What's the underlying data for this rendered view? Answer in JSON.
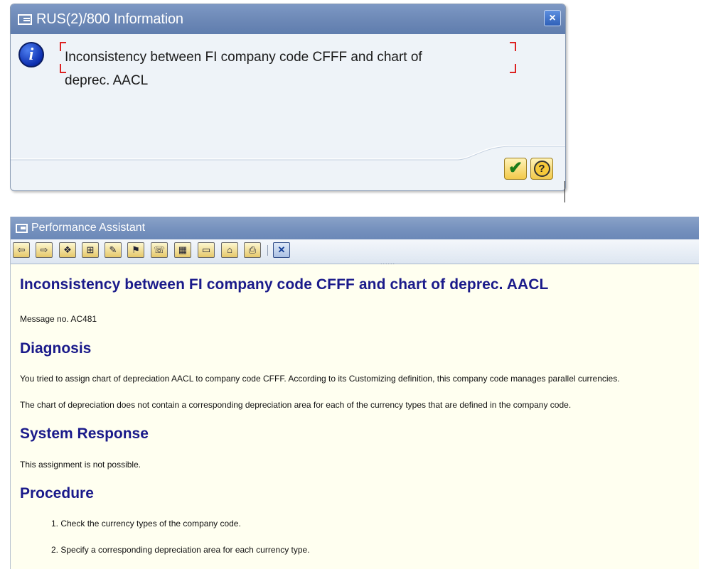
{
  "info_dialog": {
    "title": "RUS(2)/800 Information",
    "close_glyph": "×",
    "message": "Inconsistency between FI company code CFFF and chart of deprec. AACL",
    "info_glyph": "i",
    "ok_glyph": "✔",
    "help_glyph": "?"
  },
  "assistant": {
    "title": "Performance Assistant",
    "grip": "......",
    "toolbar": [
      {
        "name": "back",
        "glyph": "⇦"
      },
      {
        "name": "forward",
        "glyph": "⇨"
      },
      {
        "name": "book",
        "glyph": "❖"
      },
      {
        "name": "tree",
        "glyph": "⊞"
      },
      {
        "name": "edit",
        "glyph": "✎"
      },
      {
        "name": "technical",
        "glyph": "⚑"
      },
      {
        "name": "print-preview",
        "glyph": "☏"
      },
      {
        "name": "grid",
        "glyph": "▦"
      },
      {
        "name": "display",
        "glyph": "▭"
      },
      {
        "name": "settings",
        "glyph": "⌂"
      },
      {
        "name": "print",
        "glyph": "⎙"
      },
      {
        "name": "close",
        "glyph": "✕"
      }
    ],
    "heading": "Inconsistency between FI company code CFFF and chart of deprec. AACL",
    "message_no": "Message no. AC481",
    "diagnosis": {
      "title": "Diagnosis",
      "p1": "You tried to assign chart of depreciation AACL to company code CFFF. According to its Customizing definition, this company code manages parallel currencies.",
      "p2": "The chart of depreciation does not contain a corresponding depreciation area for each of the currency types that are defined in the company code."
    },
    "system_response": {
      "title": "System Response",
      "p1": "This assignment is not possible."
    },
    "procedure": {
      "title": "Procedure",
      "steps": [
        "1. Check the currency types of the company code.",
        "2. Specify a corresponding depreciation area for each currency type."
      ]
    }
  }
}
